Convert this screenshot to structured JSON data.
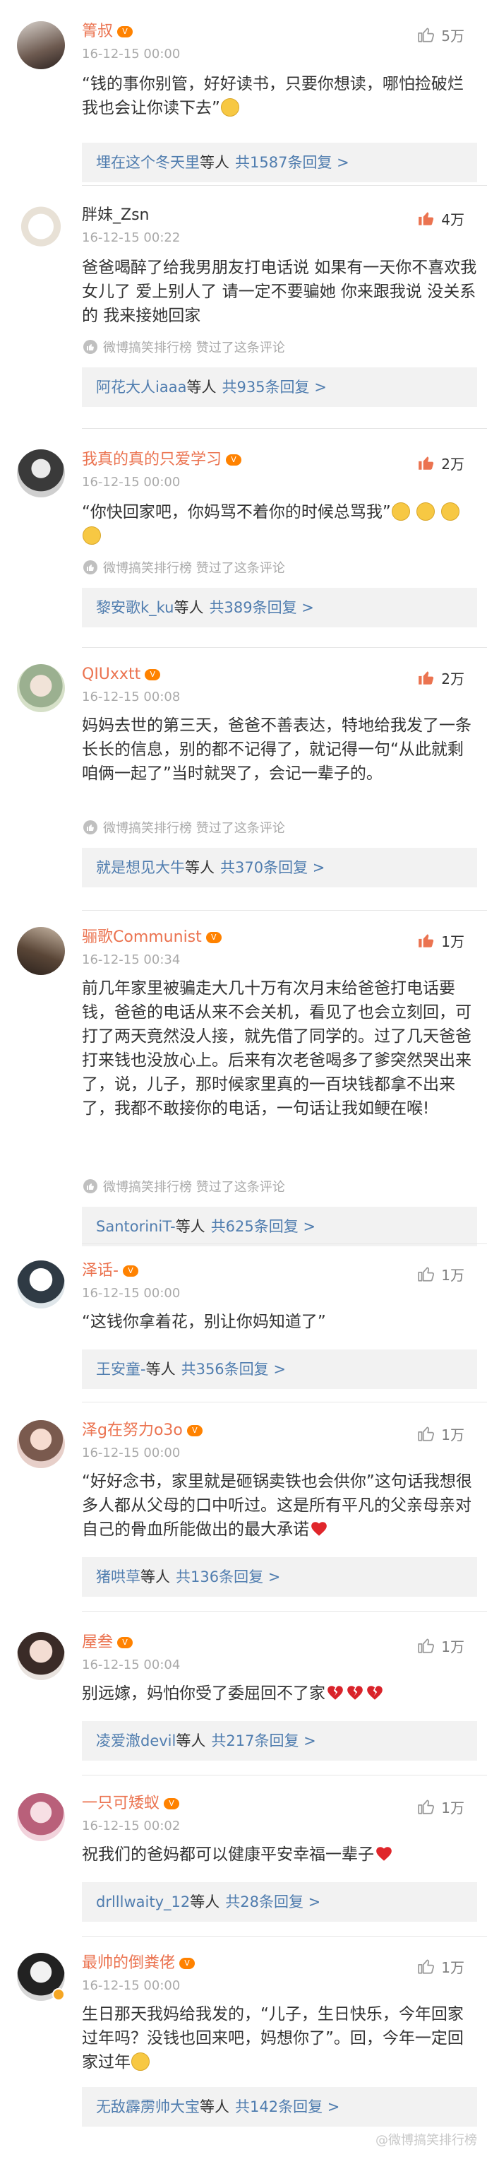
{
  "comments": [
    {
      "name": "箐叔",
      "name_color": "#eb7350",
      "badge": "vip",
      "time": "16-12-15 00:00",
      "likes": "5万",
      "like_hot": false,
      "text": "“钱的事你别管，好好读书，只要你想读，哪怕捡破烂我也会让你读下去”",
      "text_emojis": [
        "sad-face"
      ],
      "author_liked": "",
      "reply_names": "埋在这个冬天里",
      "reply_suffix": "等人",
      "reply_count": "共1587条回复 >"
    },
    {
      "name": "胖妹_Zsn",
      "name_color": "#333333",
      "badge": "",
      "time": "16-12-15 00:22",
      "likes": "4万",
      "like_hot": true,
      "text": "爸爸喝醉了给我男朋友打电话说 如果有一天你不喜欢我女儿了 爱上别人了  请一定不要骗她 你来跟我说 没关系的 我来接她回家",
      "text_emojis": [],
      "author_liked": "微博搞笑排行榜 赞过了这条评论",
      "reply_names": "阿花大人iaaa",
      "reply_suffix": "等人",
      "reply_count": "共935条回复 >"
    },
    {
      "name": "我真的真的只爱学习",
      "name_color": "#eb7350",
      "badge": "vip",
      "time": "16-12-15 00:00",
      "likes": "2万",
      "like_hot": true,
      "text": "“你快回家吧，你妈骂不着你的时候总骂我”",
      "text_emojis": [
        "chick",
        "chick",
        "chick",
        "chick"
      ],
      "author_liked": "微博搞笑排行榜 赞过了这条评论",
      "reply_names": "黎安歌k_ku",
      "reply_suffix": "等人",
      "reply_count": "共389条回复 >"
    },
    {
      "name": "QIUxxtt",
      "name_color": "#eb7350",
      "badge": "vip",
      "time": "16-12-15 00:08",
      "likes": "2万",
      "like_hot": true,
      "text": "妈妈去世的第三天，爸爸不善表达，特地给我发了一条长长的信息，别的都不记得了，就记得一句“从此就剩咱俩一起了”当时就哭了，会记一辈子的。",
      "text_emojis": [],
      "author_liked": "微博搞笑排行榜 赞过了这条评论",
      "reply_names": "就是想见大牛",
      "reply_suffix": "等人",
      "reply_count": "共370条回复 >"
    },
    {
      "name": "骊歌Communist",
      "name_color": "#eb7350",
      "badge": "vip",
      "time": "16-12-15 00:34",
      "likes": "1万",
      "like_hot": true,
      "text": "前几年家里被骗走大几十万有次月末给爸爸打电话要钱，爸爸的电话从来不会关机，看见了也会立刻回，可打了两天竟然没人接，就先借了同学的。过了几天爸爸打来钱也没放心上。后来有次老爸喝多了爹突然哭出来了，说，儿子，那时候家里真的一百块钱都拿不出来了，我都不敢接你的电话，一句话让我如鲠在喉!",
      "text_emojis": [],
      "author_liked": "微博搞笑排行榜 赞过了这条评论",
      "reply_names": "SantoriniT-",
      "reply_suffix": "等人",
      "reply_count": "共625条回复 >"
    },
    {
      "name": "泽话-",
      "name_color": "#eb7350",
      "badge": "vip",
      "time": "16-12-15 00:00",
      "likes": "1万",
      "like_hot": false,
      "text": "“这钱你拿着花，别让你妈知道了”",
      "text_emojis": [],
      "author_liked": "",
      "reply_names": "王安童-",
      "reply_suffix": "等人",
      "reply_count": "共356条回复 >"
    },
    {
      "name": "泽g在努力o3o",
      "name_color": "#eb7350",
      "badge": "vip",
      "time": "16-12-15 00:00",
      "likes": "1万",
      "like_hot": false,
      "text": "“好好念书，家里就是砸锅卖铁也会供你”这句话我想很多人都从父母的口中听过。这是所有平凡的父亲母亲对自己的骨血所能做出的最大承诺",
      "text_emojis": [
        "heart"
      ],
      "author_liked": "",
      "reply_names": "猪哄草",
      "reply_suffix": "等人",
      "reply_count": "共136条回复 >"
    },
    {
      "name": "屋叁",
      "name_color": "#eb7350",
      "badge": "vip",
      "time": "16-12-15 00:04",
      "likes": "1万",
      "like_hot": false,
      "text": "别远嫁，妈怕你受了委屈回不了家",
      "text_emojis": [
        "broken-heart",
        "broken-heart",
        "broken-heart"
      ],
      "author_liked": "",
      "reply_names": "凌爱澈devil",
      "reply_suffix": "等人",
      "reply_count": "共217条回复 >"
    },
    {
      "name": "一只可矮蚁",
      "name_color": "#eb7350",
      "badge": "vip",
      "time": "16-12-15 00:02",
      "likes": "1万",
      "like_hot": false,
      "text": "祝我们的爸妈都可以健康平安幸福一辈子",
      "text_emojis": [
        "heart"
      ],
      "author_liked": "",
      "reply_names": "drlllwaity_12",
      "reply_suffix": "等人",
      "reply_count": "共28条回复 >"
    },
    {
      "name": "最帅的倒粪佬",
      "name_color": "#eb7350",
      "badge": "vip",
      "time": "16-12-15 00:00",
      "likes": "1万",
      "like_hot": false,
      "text": "生日那天我妈给我发的，“儿子，生日快乐，今年回家过年吗？没钱也回来吧，妈想你了”。回，今年一定回家过年",
      "text_emojis": [
        "sad-face"
      ],
      "author_liked": "",
      "reply_names": "无敌霹雳帅大宝",
      "reply_suffix": "等人",
      "reply_count": "共142条回复 >"
    }
  ],
  "watermark": "@微博搞笑排行榜",
  "colors": {
    "name": "#eb7350",
    "reply_link": "#507daf",
    "reply_bg": "#f2f2f2",
    "muted": "#aaaaaa",
    "like_hot": "#eb7350"
  }
}
